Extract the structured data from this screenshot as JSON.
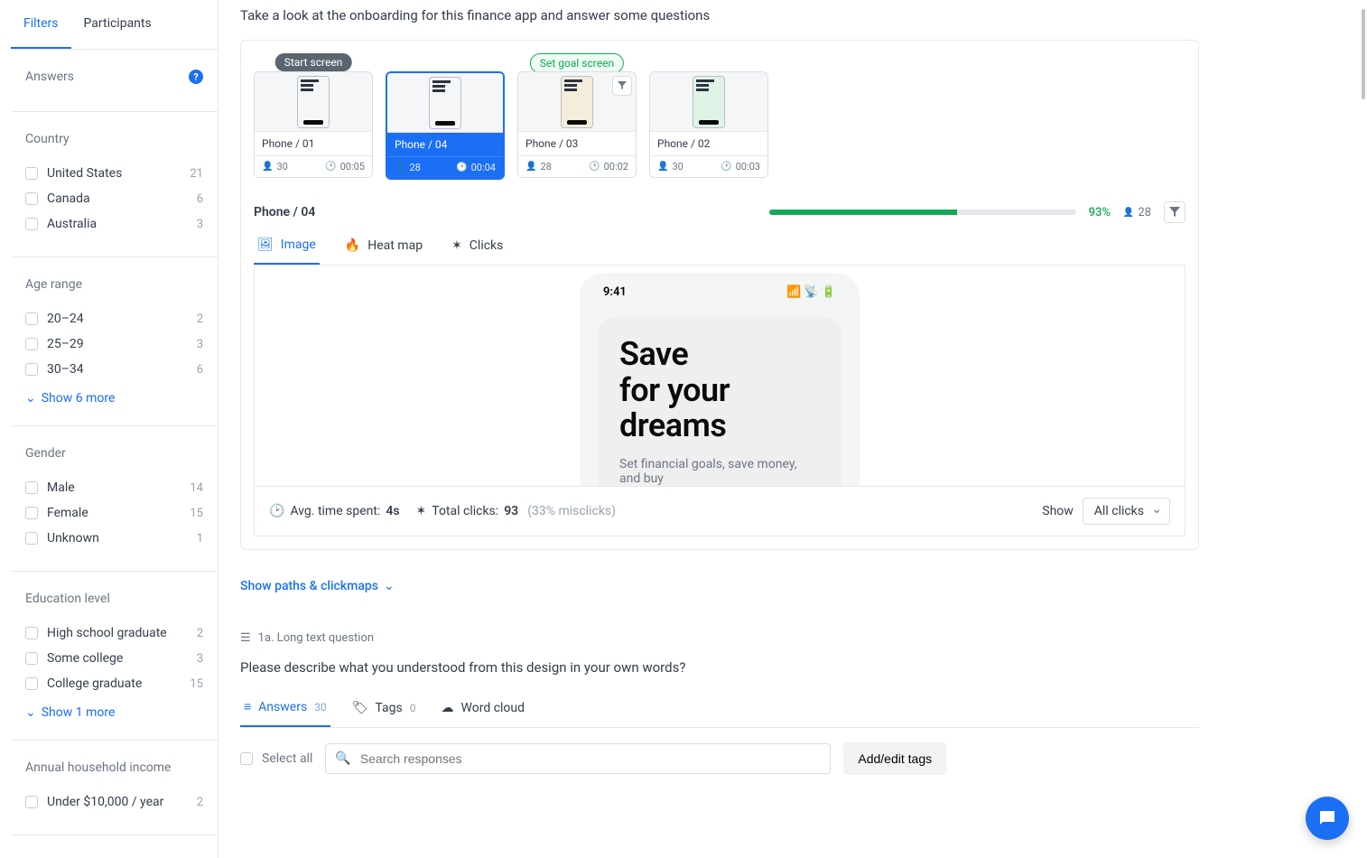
{
  "sidebar": {
    "tabs": {
      "filters": "Filters",
      "participants": "Participants"
    },
    "answers_label": "Answers",
    "groups": [
      {
        "title": "Country",
        "items": [
          {
            "label": "United States",
            "count": "21"
          },
          {
            "label": "Canada",
            "count": "6"
          },
          {
            "label": "Australia",
            "count": "3"
          }
        ],
        "show_more": null
      },
      {
        "title": "Age range",
        "items": [
          {
            "label": "20–24",
            "count": "2"
          },
          {
            "label": "25–29",
            "count": "3"
          },
          {
            "label": "30–34",
            "count": "6"
          }
        ],
        "show_more": "Show 6 more"
      },
      {
        "title": "Gender",
        "items": [
          {
            "label": "Male",
            "count": "14"
          },
          {
            "label": "Female",
            "count": "15"
          },
          {
            "label": "Unknown",
            "count": "1"
          }
        ],
        "show_more": null
      },
      {
        "title": "Education level",
        "items": [
          {
            "label": "High school graduate",
            "count": "2"
          },
          {
            "label": "Some college",
            "count": "3"
          },
          {
            "label": "College graduate",
            "count": "15"
          }
        ],
        "show_more": "Show 1 more"
      },
      {
        "title": "Annual household income",
        "items": [
          {
            "label": "Under $10,000 / year",
            "count": "2"
          }
        ],
        "show_more": null
      }
    ]
  },
  "main": {
    "intro": "Take a look at the onboarding for this finance app and answer some questions",
    "thumbs": [
      {
        "title": "Phone / 01",
        "people": "30",
        "time": "00:05",
        "badge": "Start screen",
        "mock_bg": "plain"
      },
      {
        "title": "Phone / 04",
        "people": "28",
        "time": "00:04",
        "badge": null,
        "mock_bg": "plain"
      },
      {
        "title": "Phone / 03",
        "people": "28",
        "time": "00:02",
        "badge": "Set goal screen",
        "mock_bg": "cream"
      },
      {
        "title": "Phone / 02",
        "people": "30",
        "time": "00:03",
        "badge": null,
        "mock_bg": "green"
      }
    ],
    "screen_name": "Phone / 04",
    "progress_pct": 93,
    "progress_label": "93%",
    "progress_count": "28",
    "view_tabs": {
      "image": "Image",
      "heatmap": "Heat map",
      "clicks": "Clicks"
    },
    "preview": {
      "status_time": "9:41",
      "big_title_1": "Save",
      "big_title_2": "for your",
      "big_title_3": "dreams",
      "big_sub": "Set financial goals, save money, and buy"
    },
    "stats": {
      "avg_label": "Avg. time spent:",
      "avg_val": "4s",
      "clicks_label": "Total clicks:",
      "clicks_val": "93",
      "misclicks": "(33% misclicks)",
      "show_label": "Show",
      "show_value": "All clicks"
    },
    "paths_link": "Show paths & clickmaps",
    "question": {
      "meta": "1a. Long text question",
      "text": "Please describe what you understood from this design in your own words?",
      "tabs": {
        "answers": "Answers",
        "answers_n": "30",
        "tags": "Tags",
        "tags_n": "0",
        "cloud": "Word cloud"
      },
      "controls": {
        "select_all": "Select all",
        "search_placeholder": "Search responses",
        "tag_btn": "Add/edit tags"
      }
    }
  }
}
